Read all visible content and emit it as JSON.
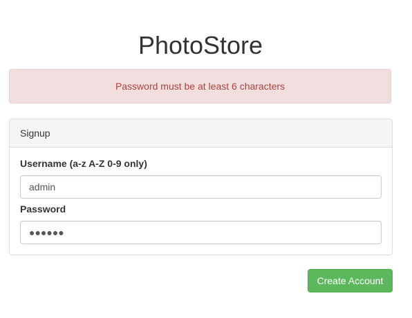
{
  "app": {
    "title": "PhotoStore"
  },
  "alert": {
    "message": "Password must be at least 6 characters",
    "colors": {
      "background": "#f2dede",
      "border": "#ebccd1",
      "text": "#a94442"
    }
  },
  "signup_panel": {
    "heading": "Signup",
    "username": {
      "label": "Username (a-z A-Z 0-9 only)",
      "value": "admin"
    },
    "password": {
      "label": "Password",
      "masked_value": "●●●●●●"
    }
  },
  "actions": {
    "create_account_label": "Create Account",
    "button_color": "#5cb85c"
  }
}
